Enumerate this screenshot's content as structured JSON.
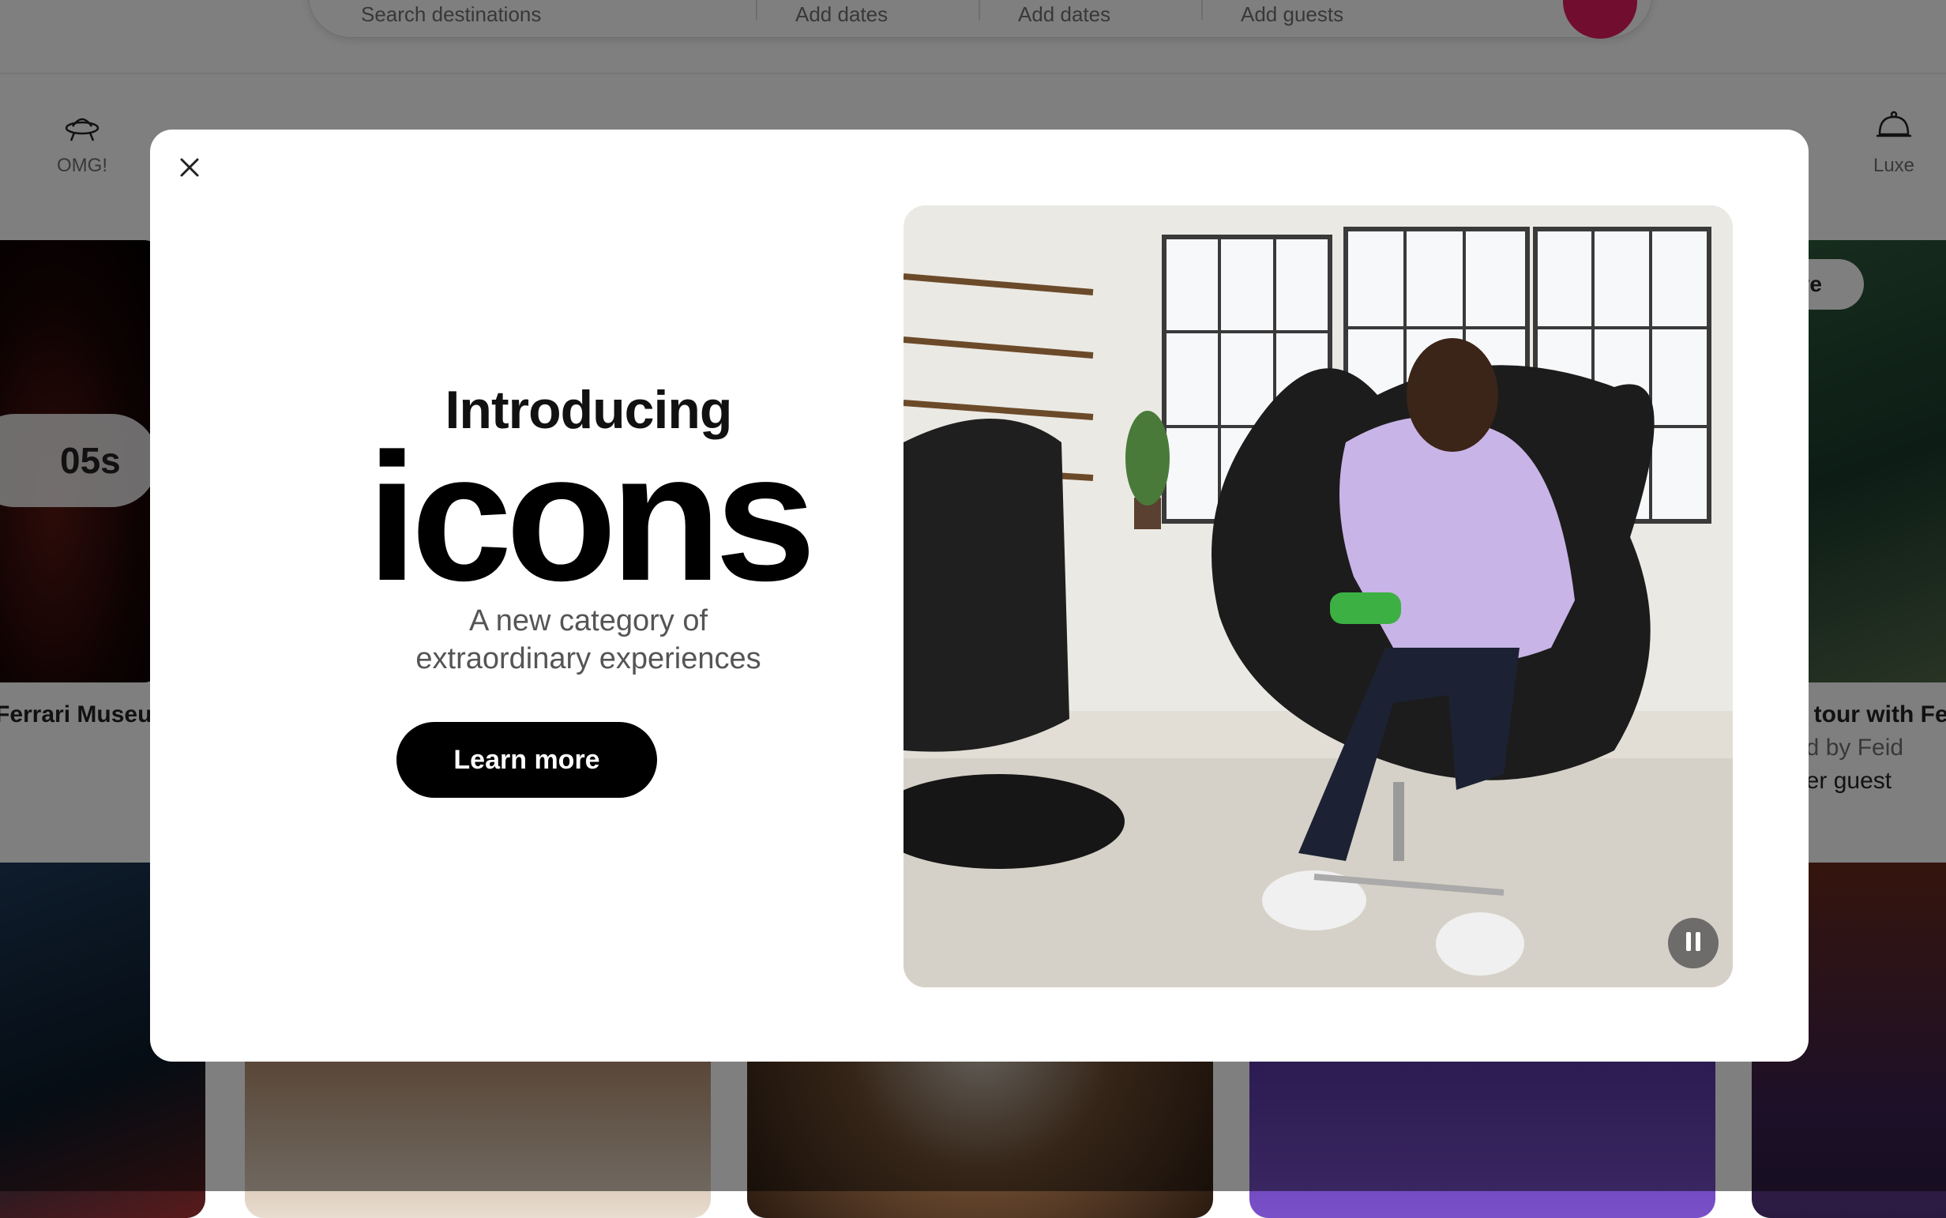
{
  "search": {
    "destination_placeholder": "Search destinations",
    "checkin_placeholder": "Add dates",
    "checkout_placeholder": "Add dates",
    "guests_placeholder": "Add guests"
  },
  "categories": [
    {
      "label": "OMG!",
      "icon": "ufo-icon"
    },
    {
      "label": "Luxe",
      "icon": "bell-icon"
    }
  ],
  "background_cards": {
    "left_title": "Ferrari Museum",
    "timer": "05s",
    "right_badge": "ive",
    "right_title": "n tour with Fe",
    "right_sub": "ed by Feid",
    "right_price": "per guest"
  },
  "modal": {
    "intro": "Introducing",
    "brand": "icons",
    "tagline_line1": "A new category of",
    "tagline_line2": "extraordinary experiences",
    "cta": "Learn more"
  },
  "colors": {
    "accent": "#e31c5f",
    "cta_bg": "#000000",
    "overlay": "rgba(0,0,0,0.5)"
  }
}
